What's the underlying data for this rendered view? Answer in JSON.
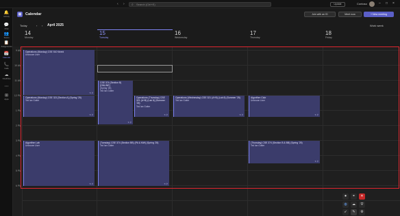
{
  "top": {
    "search_placeholder": "Search (Ctrl+E)",
    "button_label": "Update",
    "user_name": "Contoso",
    "back_icon": "‹",
    "forward_icon": "›"
  },
  "rail": [
    {
      "label": "Activity",
      "icon": "bell-icon",
      "glyph": "🔔"
    },
    {
      "label": "Chat",
      "icon": "chat-icon",
      "glyph": "💬"
    },
    {
      "label": "Teams",
      "icon": "teams-icon",
      "glyph": "👥"
    },
    {
      "label": "Assignments",
      "icon": "assignments-icon",
      "glyph": "📋"
    },
    {
      "label": "Calendar",
      "icon": "calendar-icon",
      "glyph": "📅"
    },
    {
      "label": "Calls",
      "icon": "phone-icon",
      "glyph": "📞"
    },
    {
      "label": "OneDrive",
      "icon": "cloud-icon",
      "glyph": "☁"
    },
    {
      "label": "…",
      "icon": "more-icon",
      "glyph": "⋯"
    },
    {
      "label": "Apps",
      "icon": "apps-icon",
      "glyph": "⊞"
    }
  ],
  "header": {
    "title": "Calendar",
    "join_label": "Join with an ID",
    "meet_label": "Meet now",
    "new_meeting_label": "+ New meeting"
  },
  "toolbar": {
    "today_label": "Today",
    "prev": "‹",
    "next": "›",
    "month_label": "April 2025",
    "view_label": "Work week"
  },
  "days": [
    {
      "num": "14",
      "name": "Monday"
    },
    {
      "num": "15",
      "name": "Tuesday"
    },
    {
      "num": "16",
      "name": "Wednesday"
    },
    {
      "num": "17",
      "name": "Thursday"
    },
    {
      "num": "18",
      "name": "Friday"
    }
  ],
  "hours": [
    "9 AM",
    "10 AM",
    "11 AM",
    "12 PM",
    "1 PM",
    "2 PM",
    "3 PM",
    "4 PM",
    "5 PM",
    "6 PM"
  ],
  "events": [
    {
      "title": "Operations (Monday) CSE 510 World",
      "sub": "Unknown User"
    },
    {
      "title": "CSE 374 (Section B) [ONLINE]",
      "sub": "(Spring '25)",
      "sub2": "Ted Ian Gutter"
    },
    {
      "title": "Operations (Monday) CSE 321 [Section A] (Spring '25)",
      "sub": "Ted Ian Gutter"
    },
    {
      "title": "Operations (Thursday) CSE 321 (A+B) (Lab 8) (Summer '25)",
      "sub": "Ted Ian Gutter"
    },
    {
      "title": "Operations (Wednesday) CSE 321 (A+B) (Lab 8) (Summer '25)",
      "sub": "Ted Ian Gutter"
    },
    {
      "title": "Algorithm Club",
      "sub": "Unknown User"
    },
    {
      "title": "Algorithm Lab",
      "sub": "Unknown User"
    },
    {
      "title": "(Tuesday) CSE 374 (Section BB) (PA & MW) (Spring '25)",
      "sub": "Ted Ian Gutter"
    },
    {
      "title": "(Thursday) CSE 374 (Section B & BB) (Spring '25)",
      "sub": "Ted Ian Gutter"
    }
  ],
  "tray_icons": [
    "record-icon",
    "link-icon",
    "close-icon",
    "globe-icon",
    "cloud-icon",
    "shield-icon",
    "pen-icon",
    "gear-icon"
  ]
}
